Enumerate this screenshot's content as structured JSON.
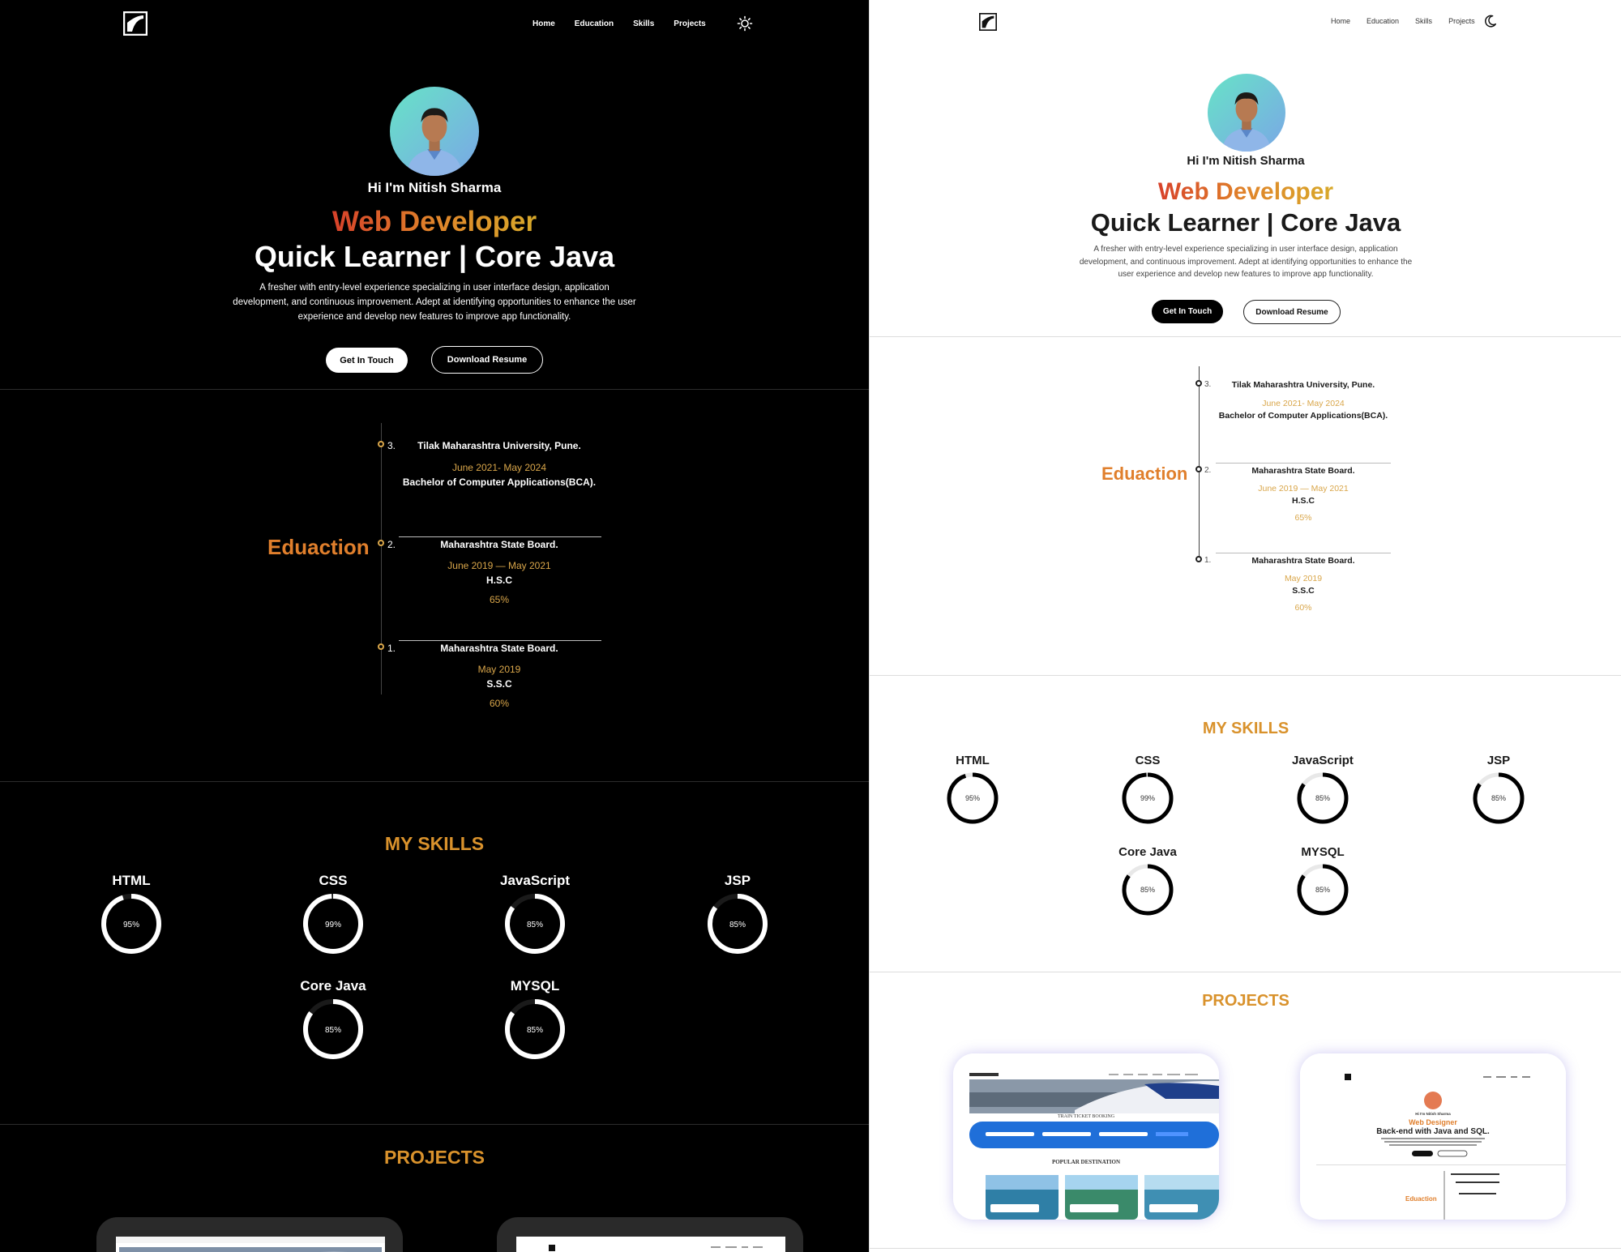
{
  "nav": {
    "home": "Home",
    "education": "Education",
    "skills": "Skills",
    "projects": "Projects"
  },
  "hero": {
    "greeting": "Hi I'm Nitish Sharma",
    "role": "Web Developer",
    "tagline": "Quick Learner | Core Java",
    "description": "A fresher with entry-level experience specializing in user interface design, application development, and continuous improvement. Adept at identifying opportunities to enhance the user experience and develop new features to improve app functionality.",
    "cta_primary": "Get In Touch",
    "cta_secondary": "Download Resume"
  },
  "education": {
    "label": "Eduaction",
    "entries": [
      {
        "num": "3.",
        "institution": "Tilak Maharashtra University, Pune.",
        "date": "June 2021- May 2024",
        "degree": "Bachelor of Computer Applications(BCA).",
        "score": ""
      },
      {
        "num": "2.",
        "institution": "Maharashtra State Board.",
        "date": "June 2019 — May 2021",
        "degree": "H.S.C",
        "score": "65%"
      },
      {
        "num": "1.",
        "institution": "Maharashtra State Board.",
        "date": "May 2019",
        "degree": "S.S.C",
        "score": "60%"
      }
    ]
  },
  "skills": {
    "title": "MY SKILLS",
    "items": [
      {
        "name": "HTML",
        "percent": 95,
        "label": "95%"
      },
      {
        "name": "CSS",
        "percent": 99,
        "label": "99%"
      },
      {
        "name": "JavaScript",
        "percent": 85,
        "label": "85%"
      },
      {
        "name": "JSP",
        "percent": 85,
        "label": "85%"
      },
      {
        "name": "Core Java",
        "percent": 85,
        "label": "85%"
      },
      {
        "name": "MYSQL",
        "percent": 85,
        "label": "85%"
      }
    ]
  },
  "projects": {
    "title": "PROJECTS",
    "thumb1": {
      "heading": "TRAIN TICKET BOOKING",
      "subheading": "POPULAR DESTINATION"
    },
    "thumb2": {
      "greeting": "Hi I'm Nitish Sharma",
      "role": "Web Designer",
      "tagline": "Back-end with Java and SQL.",
      "edu_label": "Eduaction"
    }
  },
  "colors": {
    "accent": "#d9922c",
    "date_gold": "#d9a64a",
    "edu_orange": "#e07f2c",
    "dark_bg": "#000000",
    "light_bg": "#ffffff"
  },
  "icons": {
    "logo": "logo-icon",
    "theme_dark_panel": "sun-icon",
    "theme_light_panel": "moon-icon"
  }
}
